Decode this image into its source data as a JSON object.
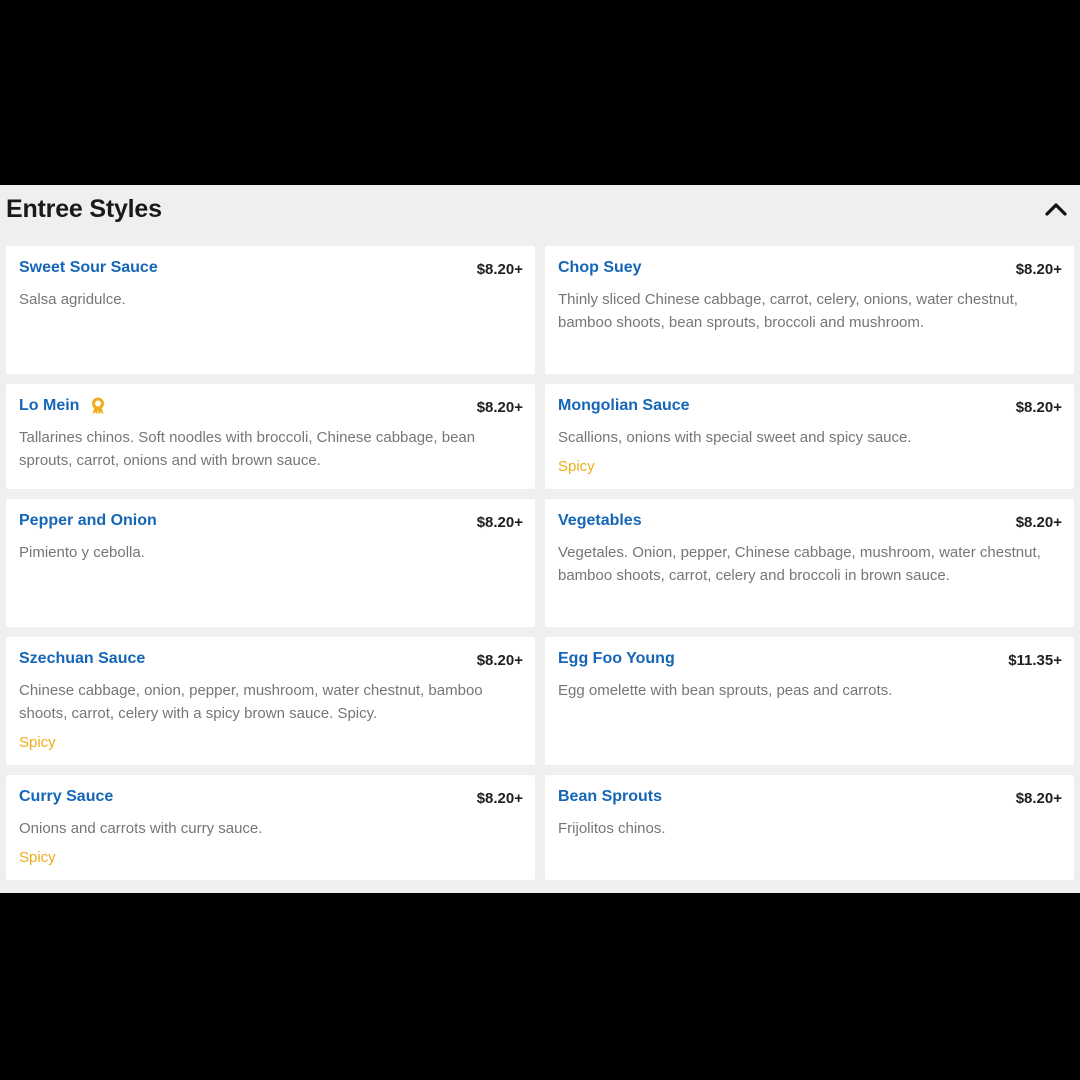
{
  "section": {
    "title": "Entree Styles",
    "collapse_icon": "chevron-up-icon"
  },
  "colors": {
    "item_name": "#1566b7",
    "spicy_tag": "#f0ad1d",
    "badge": "#f0ad1d",
    "description": "#767676",
    "background": "#efefef"
  },
  "items": [
    {
      "name": "Sweet Sour Sauce",
      "price": "$8.20+",
      "description": "Salsa agridulce.",
      "tag": ""
    },
    {
      "name": "Chop Suey",
      "price": "$8.20+",
      "description": "Thinly sliced Chinese cabbage, carrot, celery, onions, water chestnut, bamboo shoots, bean sprouts, broccoli and mushroom.",
      "tag": ""
    },
    {
      "name": "Lo Mein",
      "price": "$8.20+",
      "description": "Tallarines chinos. Soft noodles with broccoli, Chinese cabbage, bean sprouts, carrot, onions and with brown sauce.",
      "tag": "",
      "badge_icon": "award-ribbon-icon"
    },
    {
      "name": "Mongolian Sauce",
      "price": "$8.20+",
      "description": "Scallions, onions with special sweet and spicy sauce.",
      "tag": "Spicy"
    },
    {
      "name": "Pepper and Onion",
      "price": "$8.20+",
      "description": "Pimiento y cebolla.",
      "tag": ""
    },
    {
      "name": "Vegetables",
      "price": "$8.20+",
      "description": "Vegetales. Onion, pepper, Chinese cabbage, mushroom, water chestnut, bamboo shoots, carrot, celery and broccoli in brown sauce.",
      "tag": ""
    },
    {
      "name": "Szechuan Sauce",
      "price": "$8.20+",
      "description": "Chinese cabbage, onion, pepper, mushroom, water chestnut, bamboo shoots, carrot, celery with a spicy brown sauce. Spicy.",
      "tag": "Spicy"
    },
    {
      "name": "Egg Foo Young",
      "price": "$11.35+",
      "description": "Egg omelette with bean sprouts, peas and carrots.",
      "tag": ""
    },
    {
      "name": "Curry Sauce",
      "price": "$8.20+",
      "description": "Onions and carrots with curry sauce.",
      "tag": "Spicy"
    },
    {
      "name": "Bean Sprouts",
      "price": "$8.20+",
      "description": "Frijolitos chinos.",
      "tag": ""
    }
  ]
}
